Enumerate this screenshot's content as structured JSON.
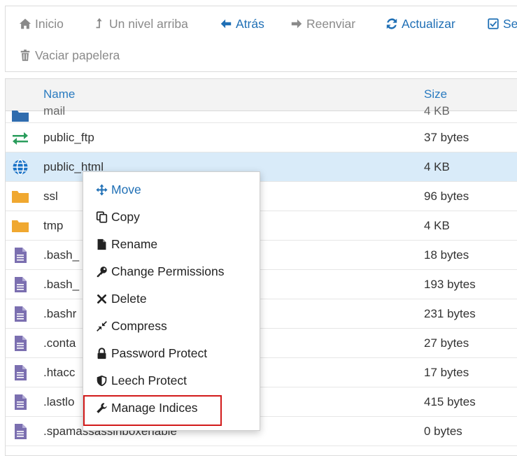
{
  "toolbar": {
    "home": "Inicio",
    "up": "Un nivel arriba",
    "back": "Atrás",
    "forward": "Reenviar",
    "refresh": "Actualizar",
    "select_all": "Se",
    "empty_trash": "Vaciar papelera"
  },
  "table": {
    "col_name": "Name",
    "col_size": "Size",
    "rows": [
      {
        "name": "mail",
        "size": "4 KB",
        "icon": "folder-icon"
      },
      {
        "name": "public_ftp",
        "size": "37 bytes",
        "icon": "transfer-arrows-icon"
      },
      {
        "name": "public_html",
        "size": "4 KB",
        "icon": "globe-icon"
      },
      {
        "name": "ssl",
        "size": "96 bytes",
        "icon": "folder-icon"
      },
      {
        "name": "tmp",
        "size": "4 KB",
        "icon": "folder-icon"
      },
      {
        "name": ".bash_",
        "size": "18 bytes",
        "icon": "file-icon"
      },
      {
        "name": ".bash_",
        "size": "193 bytes",
        "icon": "file-icon"
      },
      {
        "name": ".bashr",
        "size": "231 bytes",
        "icon": "file-icon"
      },
      {
        "name": ".conta",
        "size": "27 bytes",
        "icon": "file-icon"
      },
      {
        "name": ".htacc",
        "size": "17 bytes",
        "icon": "file-icon"
      },
      {
        "name": ".lastlo",
        "size": "415 bytes",
        "icon": "file-icon"
      },
      {
        "name": ".spamassassinboxenable",
        "size": "0 bytes",
        "icon": "file-icon"
      }
    ]
  },
  "context_menu": {
    "items": [
      {
        "label": "Move",
        "icon": "move-icon"
      },
      {
        "label": "Copy",
        "icon": "copy-icon"
      },
      {
        "label": "Rename",
        "icon": "file-icon"
      },
      {
        "label": "Change Permissions",
        "icon": "key-icon"
      },
      {
        "label": "Delete",
        "icon": "close-icon"
      },
      {
        "label": "Compress",
        "icon": "compress-icon"
      },
      {
        "label": "Password Protect",
        "icon": "lock-icon"
      },
      {
        "label": "Leech Protect",
        "icon": "shield-icon"
      },
      {
        "label": "Manage Indices",
        "icon": "wrench-icon"
      }
    ]
  },
  "colors": {
    "accent": "#1f6fb5",
    "folder": "#f0a830",
    "file": "#7b6fb0",
    "globe": "#1a73c7",
    "transfer": "#2a9d5c",
    "highlight": "#d21a1a",
    "selected_row": "#d9ebf9"
  }
}
